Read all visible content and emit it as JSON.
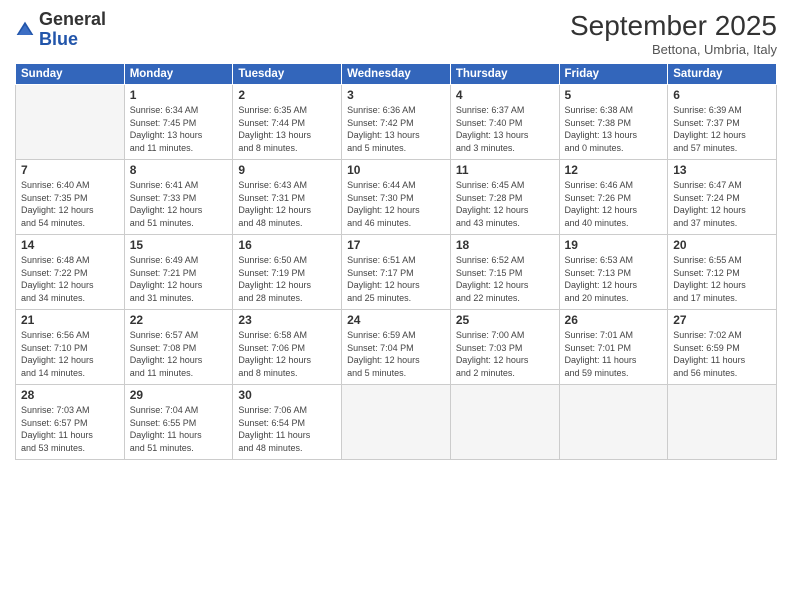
{
  "header": {
    "logo_general": "General",
    "logo_blue": "Blue",
    "month": "September 2025",
    "location": "Bettona, Umbria, Italy"
  },
  "weekdays": [
    "Sunday",
    "Monday",
    "Tuesday",
    "Wednesday",
    "Thursday",
    "Friday",
    "Saturday"
  ],
  "weeks": [
    [
      {
        "day": "",
        "info": ""
      },
      {
        "day": "1",
        "info": "Sunrise: 6:34 AM\nSunset: 7:45 PM\nDaylight: 13 hours\nand 11 minutes."
      },
      {
        "day": "2",
        "info": "Sunrise: 6:35 AM\nSunset: 7:44 PM\nDaylight: 13 hours\nand 8 minutes."
      },
      {
        "day": "3",
        "info": "Sunrise: 6:36 AM\nSunset: 7:42 PM\nDaylight: 13 hours\nand 5 minutes."
      },
      {
        "day": "4",
        "info": "Sunrise: 6:37 AM\nSunset: 7:40 PM\nDaylight: 13 hours\nand 3 minutes."
      },
      {
        "day": "5",
        "info": "Sunrise: 6:38 AM\nSunset: 7:38 PM\nDaylight: 13 hours\nand 0 minutes."
      },
      {
        "day": "6",
        "info": "Sunrise: 6:39 AM\nSunset: 7:37 PM\nDaylight: 12 hours\nand 57 minutes."
      }
    ],
    [
      {
        "day": "7",
        "info": "Sunrise: 6:40 AM\nSunset: 7:35 PM\nDaylight: 12 hours\nand 54 minutes."
      },
      {
        "day": "8",
        "info": "Sunrise: 6:41 AM\nSunset: 7:33 PM\nDaylight: 12 hours\nand 51 minutes."
      },
      {
        "day": "9",
        "info": "Sunrise: 6:43 AM\nSunset: 7:31 PM\nDaylight: 12 hours\nand 48 minutes."
      },
      {
        "day": "10",
        "info": "Sunrise: 6:44 AM\nSunset: 7:30 PM\nDaylight: 12 hours\nand 46 minutes."
      },
      {
        "day": "11",
        "info": "Sunrise: 6:45 AM\nSunset: 7:28 PM\nDaylight: 12 hours\nand 43 minutes."
      },
      {
        "day": "12",
        "info": "Sunrise: 6:46 AM\nSunset: 7:26 PM\nDaylight: 12 hours\nand 40 minutes."
      },
      {
        "day": "13",
        "info": "Sunrise: 6:47 AM\nSunset: 7:24 PM\nDaylight: 12 hours\nand 37 minutes."
      }
    ],
    [
      {
        "day": "14",
        "info": "Sunrise: 6:48 AM\nSunset: 7:22 PM\nDaylight: 12 hours\nand 34 minutes."
      },
      {
        "day": "15",
        "info": "Sunrise: 6:49 AM\nSunset: 7:21 PM\nDaylight: 12 hours\nand 31 minutes."
      },
      {
        "day": "16",
        "info": "Sunrise: 6:50 AM\nSunset: 7:19 PM\nDaylight: 12 hours\nand 28 minutes."
      },
      {
        "day": "17",
        "info": "Sunrise: 6:51 AM\nSunset: 7:17 PM\nDaylight: 12 hours\nand 25 minutes."
      },
      {
        "day": "18",
        "info": "Sunrise: 6:52 AM\nSunset: 7:15 PM\nDaylight: 12 hours\nand 22 minutes."
      },
      {
        "day": "19",
        "info": "Sunrise: 6:53 AM\nSunset: 7:13 PM\nDaylight: 12 hours\nand 20 minutes."
      },
      {
        "day": "20",
        "info": "Sunrise: 6:55 AM\nSunset: 7:12 PM\nDaylight: 12 hours\nand 17 minutes."
      }
    ],
    [
      {
        "day": "21",
        "info": "Sunrise: 6:56 AM\nSunset: 7:10 PM\nDaylight: 12 hours\nand 14 minutes."
      },
      {
        "day": "22",
        "info": "Sunrise: 6:57 AM\nSunset: 7:08 PM\nDaylight: 12 hours\nand 11 minutes."
      },
      {
        "day": "23",
        "info": "Sunrise: 6:58 AM\nSunset: 7:06 PM\nDaylight: 12 hours\nand 8 minutes."
      },
      {
        "day": "24",
        "info": "Sunrise: 6:59 AM\nSunset: 7:04 PM\nDaylight: 12 hours\nand 5 minutes."
      },
      {
        "day": "25",
        "info": "Sunrise: 7:00 AM\nSunset: 7:03 PM\nDaylight: 12 hours\nand 2 minutes."
      },
      {
        "day": "26",
        "info": "Sunrise: 7:01 AM\nSunset: 7:01 PM\nDaylight: 11 hours\nand 59 minutes."
      },
      {
        "day": "27",
        "info": "Sunrise: 7:02 AM\nSunset: 6:59 PM\nDaylight: 11 hours\nand 56 minutes."
      }
    ],
    [
      {
        "day": "28",
        "info": "Sunrise: 7:03 AM\nSunset: 6:57 PM\nDaylight: 11 hours\nand 53 minutes."
      },
      {
        "day": "29",
        "info": "Sunrise: 7:04 AM\nSunset: 6:55 PM\nDaylight: 11 hours\nand 51 minutes."
      },
      {
        "day": "30",
        "info": "Sunrise: 7:06 AM\nSunset: 6:54 PM\nDaylight: 11 hours\nand 48 minutes."
      },
      {
        "day": "",
        "info": ""
      },
      {
        "day": "",
        "info": ""
      },
      {
        "day": "",
        "info": ""
      },
      {
        "day": "",
        "info": ""
      }
    ]
  ]
}
